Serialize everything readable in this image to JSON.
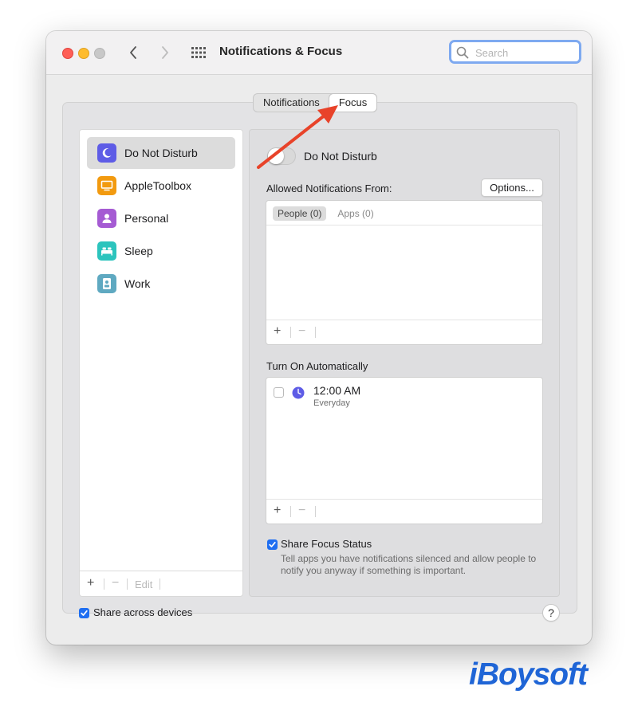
{
  "window": {
    "title": "Notifications & Focus",
    "search": {
      "placeholder": "Search",
      "value": ""
    }
  },
  "tabs": [
    {
      "label": "Notifications",
      "active": false
    },
    {
      "label": "Focus",
      "active": true
    }
  ],
  "sidebar": {
    "items": [
      {
        "label": "Do Not Disturb",
        "icon": "moon-icon",
        "color": "#5e5ce6",
        "selected": true
      },
      {
        "label": "AppleToolbox",
        "icon": "monitor-icon",
        "color": "#f29a0f",
        "selected": false
      },
      {
        "label": "Personal",
        "icon": "person-icon",
        "color": "#a55bd3",
        "selected": false
      },
      {
        "label": "Sleep",
        "icon": "bed-icon",
        "color": "#2cc4bd",
        "selected": false
      },
      {
        "label": "Work",
        "icon": "badge-icon",
        "color": "#5fa9c1",
        "selected": false
      }
    ],
    "footer": {
      "add": "+",
      "remove": "−",
      "edit": "Edit"
    }
  },
  "detail": {
    "focus_name": "Do Not Disturb",
    "toggle_on": false,
    "allowed_label": "Allowed Notifications From:",
    "options_label": "Options...",
    "subtabs": [
      {
        "label": "People (0)",
        "active": true
      },
      {
        "label": "Apps (0)",
        "active": false
      }
    ],
    "list_footer": {
      "add": "+",
      "remove": "−"
    },
    "auto_label": "Turn On Automatically",
    "schedule": [
      {
        "time": "12:00 AM",
        "days": "Everyday",
        "enabled": false
      }
    ],
    "share_focus": {
      "label": "Share Focus Status",
      "checked": true,
      "description": "Tell apps you have notifications silenced and allow people to notify you anyway if something is important."
    }
  },
  "bottom": {
    "share_devices": {
      "label": "Share across devices",
      "checked": true
    },
    "help": "?"
  },
  "annotation": {
    "color": "#e8432a"
  },
  "brand": "iBoysoft"
}
